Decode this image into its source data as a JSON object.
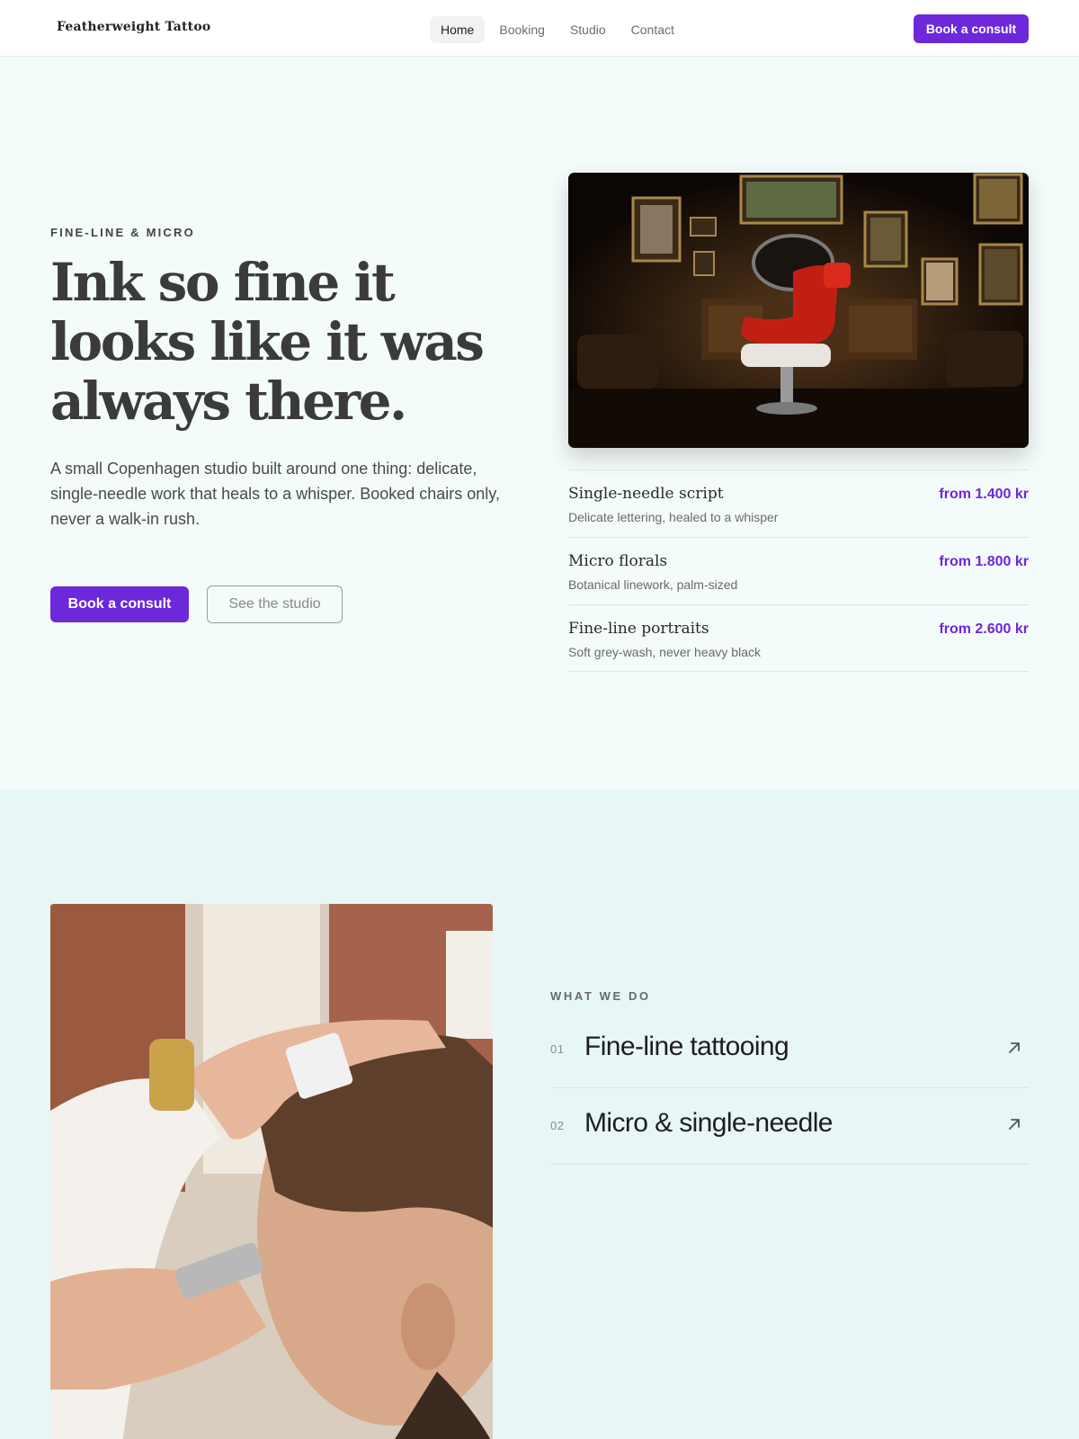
{
  "nav": {
    "brand": "Featherweight Tattoo",
    "links": [
      {
        "label": "Home",
        "active": true
      },
      {
        "label": "Booking",
        "active": false
      },
      {
        "label": "Studio",
        "active": false
      },
      {
        "label": "Contact",
        "active": false
      }
    ],
    "cta_label": "Book a consult"
  },
  "hero": {
    "eyebrow": "FINE-LINE & MICRO",
    "headline": "Ink so fine it looks like it was always there.",
    "lede": "A small Copenhagen studio built around one thing: delicate, single-needle work that heals to a whisper. Booked chairs only, never a walk-in rush.",
    "primary_cta": "Book a consult",
    "secondary_cta": "See the studio",
    "services": [
      {
        "name": "Single-needle script",
        "desc": "Delicate lettering, healed to a whisper",
        "price": "from 1.400 kr"
      },
      {
        "name": "Micro florals",
        "desc": "Botanical linework, palm-sized",
        "price": "from 1.800 kr"
      },
      {
        "name": "Fine-line portraits",
        "desc": "Soft grey-wash, never heavy black",
        "price": "from 2.600 kr"
      }
    ]
  },
  "what_we_do": {
    "label": "WHAT WE DO",
    "items": [
      {
        "num": "01",
        "title": "Fine-line tattooing"
      },
      {
        "num": "02",
        "title": "Micro & single-needle"
      }
    ]
  },
  "colors": {
    "accent": "#6d28d9",
    "hero_bg": "#f4fbfb",
    "section_bg": "#e9f6f7"
  }
}
